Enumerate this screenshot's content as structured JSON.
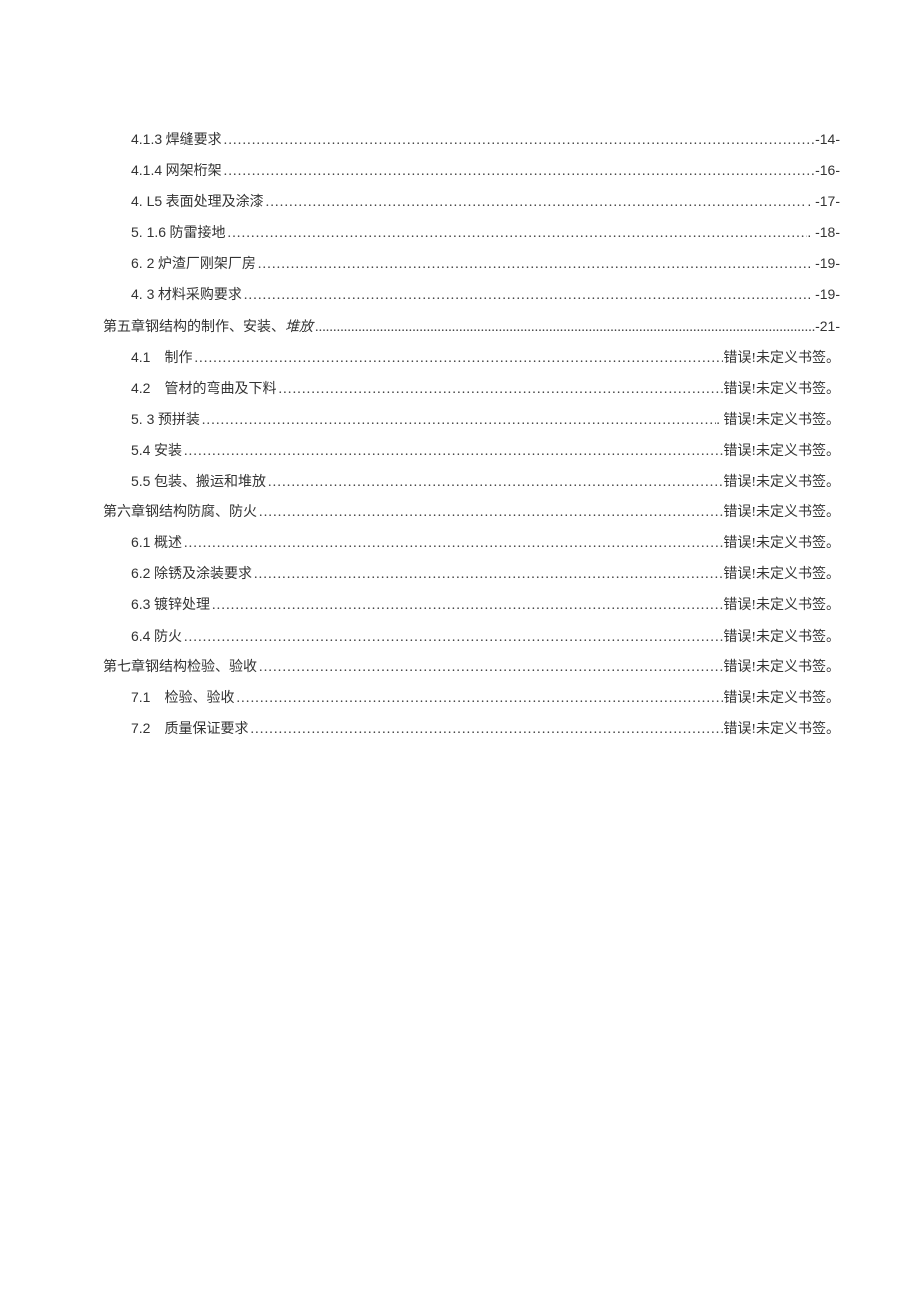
{
  "toc": [
    {
      "level": 2,
      "num": "4.1.3",
      "title_cn": " 焊缝要求 ",
      "page": "-14-",
      "italic": false
    },
    {
      "level": 2,
      "num": "4.1.4",
      "title_cn": " 网架桁架 ",
      "page": "-16-",
      "italic": false
    },
    {
      "level": 2,
      "num": "4.  L5",
      "title_cn": " 表面处理及涂漆 ",
      "page": "-17-",
      "italic": false,
      "dotPrefix": ". "
    },
    {
      "level": 2,
      "num": "5.  1.6",
      "title_cn": " 防雷接地 ",
      "page": "-18-",
      "italic": false,
      "dotPrefix": ". "
    },
    {
      "level": 2,
      "num": "6.  2",
      "title_cn": " 炉渣厂刚架厂房 ",
      "page": "-19-",
      "italic": false,
      "dotPrefix": ". "
    },
    {
      "level": 2,
      "num": "4.  3",
      "title_cn": " 材料采购要求 ",
      "page": "-19-",
      "italic": false,
      "dotPrefix": ". "
    },
    {
      "level": 1,
      "pre_cn": "第五章钢结构的制作、安装、",
      "post_cn_italic": "堆放",
      "page": "-21-",
      "thin": true
    },
    {
      "level": 2,
      "num": "4.1",
      "gap": true,
      "title_cn": "制作 ",
      "page": "错误!未定义书签。"
    },
    {
      "level": 2,
      "num": "4.2",
      "gap": true,
      "title_cn": "管材的弯曲及下料 ",
      "page": "错误!未定义书签。"
    },
    {
      "level": 2,
      "num": "5.  3",
      "title_cn": " 预拼装 ",
      "page": "错误!未定义书签。",
      "dotPrefix": ". "
    },
    {
      "level": 2,
      "num": "5.4",
      "title_cn": " 安装 ",
      "page": "错误!未定义书签。"
    },
    {
      "level": 2,
      "num": "5.5",
      "title_cn": " 包装、搬运和堆放 ",
      "page": "错误!未定义书签。"
    },
    {
      "level": 1,
      "pre_cn": "第六章钢结构防腐、防火 ",
      "page": "错误!未定义书签。"
    },
    {
      "level": 2,
      "num": "6.1",
      "title_cn": " 概述 ",
      "page": "错误!未定义书签。"
    },
    {
      "level": 2,
      "num": "6.2",
      "title_cn": " 除锈及涂装要求 ",
      "page": "错误!未定义书签。"
    },
    {
      "level": 2,
      "num": "6.3",
      "title_cn": " 镀锌处理 ",
      "page": "错误!未定义书签。"
    },
    {
      "level": 2,
      "num": "6.4",
      "title_cn": " 防火 ",
      "page": "错误!未定义书签。"
    },
    {
      "level": 1,
      "pre_cn": "第七章钢结构检验、验收 ",
      "page": "错误!未定义书签。"
    },
    {
      "level": 2,
      "num": "7.1",
      "gap": true,
      "title_cn": "检验、验收 ",
      "page": "错误!未定义书签。"
    },
    {
      "level": 2,
      "num": "7.2",
      "gap": true,
      "title_cn": "质量保证要求 ",
      "page": "错误!未定义书签。"
    }
  ]
}
